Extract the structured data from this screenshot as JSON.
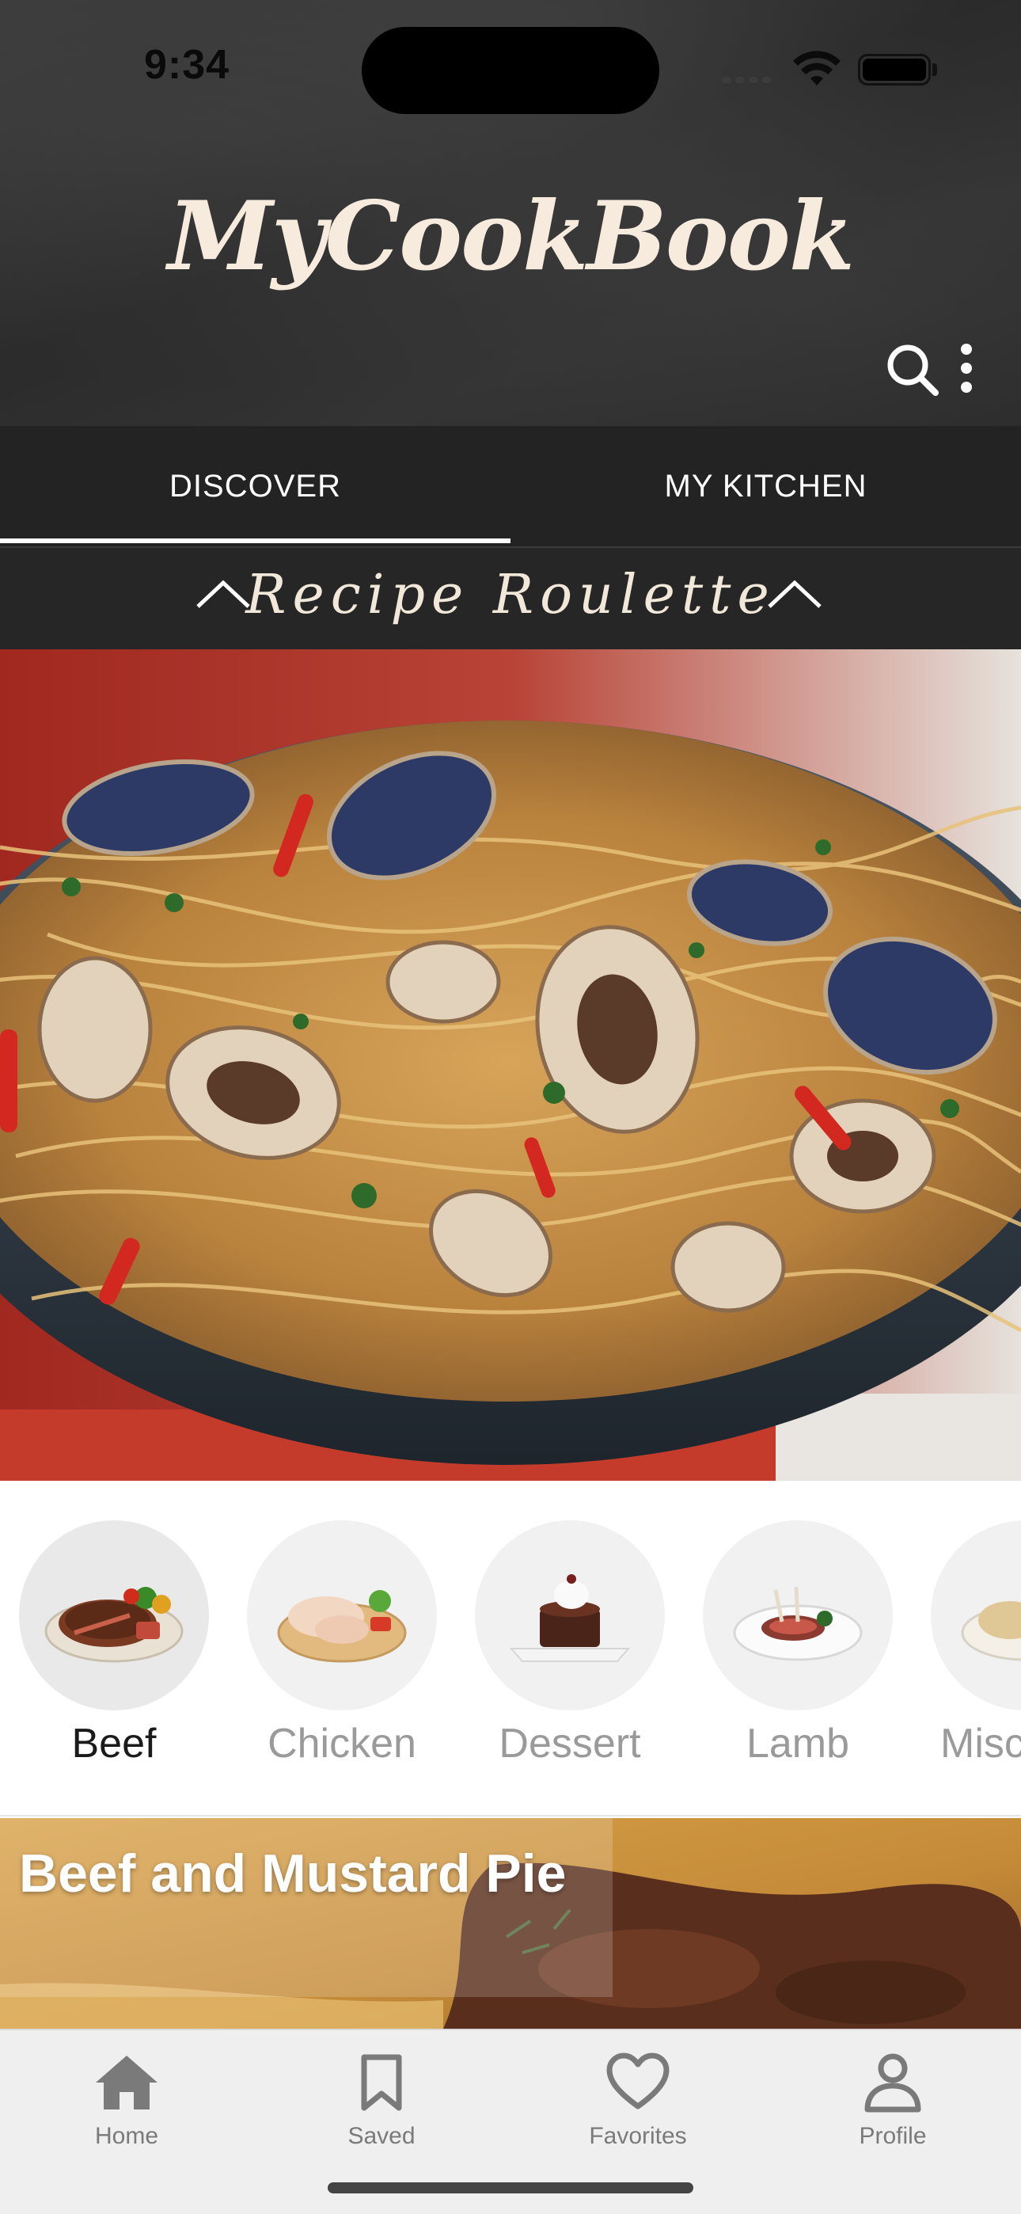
{
  "status_bar": {
    "time": "9:34"
  },
  "header": {
    "app_title": "MyCookBook"
  },
  "tabs": [
    {
      "label": "DISCOVER",
      "active": true
    },
    {
      "label": "MY KITCHEN",
      "active": false
    }
  ],
  "roulette": {
    "title": "Recipe Roulette"
  },
  "categories": [
    {
      "label": "Beef",
      "selected": true
    },
    {
      "label": "Chicken",
      "selected": false
    },
    {
      "label": "Dessert",
      "selected": false
    },
    {
      "label": "Lamb",
      "selected": false
    },
    {
      "label": "Misce",
      "selected": false
    }
  ],
  "recipe_card": {
    "title": "Beef and Mustard Pie"
  },
  "bottom_nav": [
    {
      "label": "Home",
      "icon": "home-icon"
    },
    {
      "label": "Saved",
      "icon": "bookmark-icon"
    },
    {
      "label": "Favorites",
      "icon": "heart-icon"
    },
    {
      "label": "Profile",
      "icon": "person-icon"
    }
  ],
  "colors": {
    "header_bg": "#2e2e2e",
    "tabs_bg": "#232323",
    "title_cream": "#f6ebdd",
    "nav_bg": "#efefef",
    "nav_icon": "#7a7a7a"
  }
}
